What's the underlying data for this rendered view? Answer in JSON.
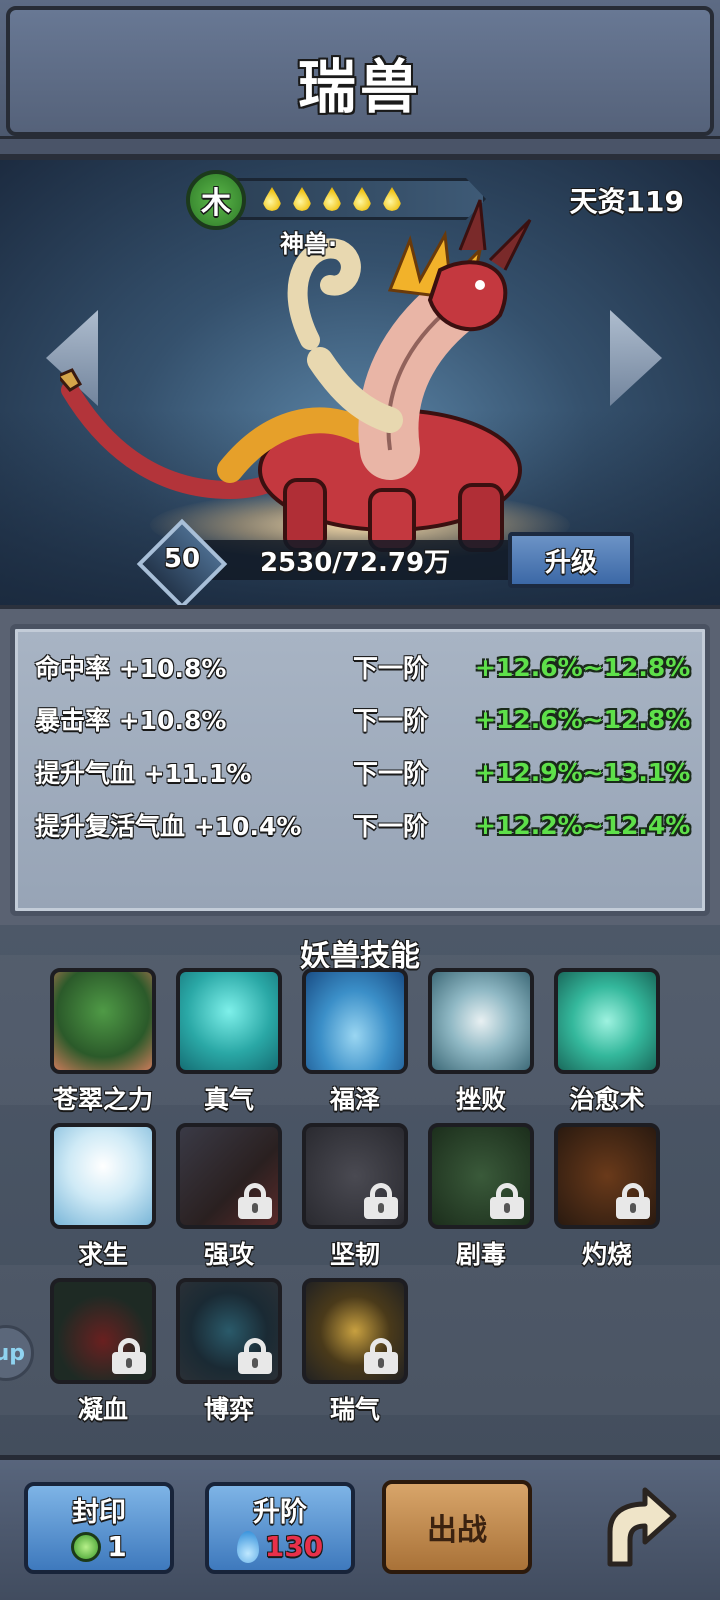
{
  "header": {
    "title": "瑞兽"
  },
  "beast": {
    "element": "木",
    "stars": 5,
    "talent": "天资119",
    "species": "神兽·",
    "level": "50",
    "exp": "2530/72.79万",
    "upgrade_label": "升级"
  },
  "stats": [
    {
      "label": "命中率 +10.8%",
      "next": "下一阶",
      "value": "+12.6%~12.8%"
    },
    {
      "label": "暴击率 +10.8%",
      "next": "下一阶",
      "value": "+12.6%~12.8%"
    },
    {
      "label": "提升气血 +11.1%",
      "next": "下一阶",
      "value": "+12.9%~13.1%"
    },
    {
      "label": "提升复活气血 +10.4%",
      "next": "下一阶",
      "value": "+12.2%~12.4%"
    }
  ],
  "skills": {
    "title": "妖兽技能",
    "items": [
      {
        "name": "苍翠之力",
        "locked": false
      },
      {
        "name": "真气",
        "locked": false
      },
      {
        "name": "福泽",
        "locked": false
      },
      {
        "name": "挫败",
        "locked": false
      },
      {
        "name": "治愈术",
        "locked": false
      },
      {
        "name": "求生",
        "locked": false
      },
      {
        "name": "强攻",
        "locked": true
      },
      {
        "name": "坚韧",
        "locked": true
      },
      {
        "name": "剧毒",
        "locked": true
      },
      {
        "name": "灼烧",
        "locked": true
      },
      {
        "name": "凝血",
        "locked": true
      },
      {
        "name": "博弈",
        "locked": true
      },
      {
        "name": "瑞气",
        "locked": true
      }
    ]
  },
  "side_tab": {
    "label": "up"
  },
  "actions": {
    "seal": {
      "label": "封印",
      "count": "1"
    },
    "advance": {
      "label": "升阶",
      "count": "130"
    },
    "battle": {
      "label": "出战"
    }
  },
  "colors": {
    "bonus_green": "#5ee04a",
    "advance_cost_red": "#e8304a"
  }
}
